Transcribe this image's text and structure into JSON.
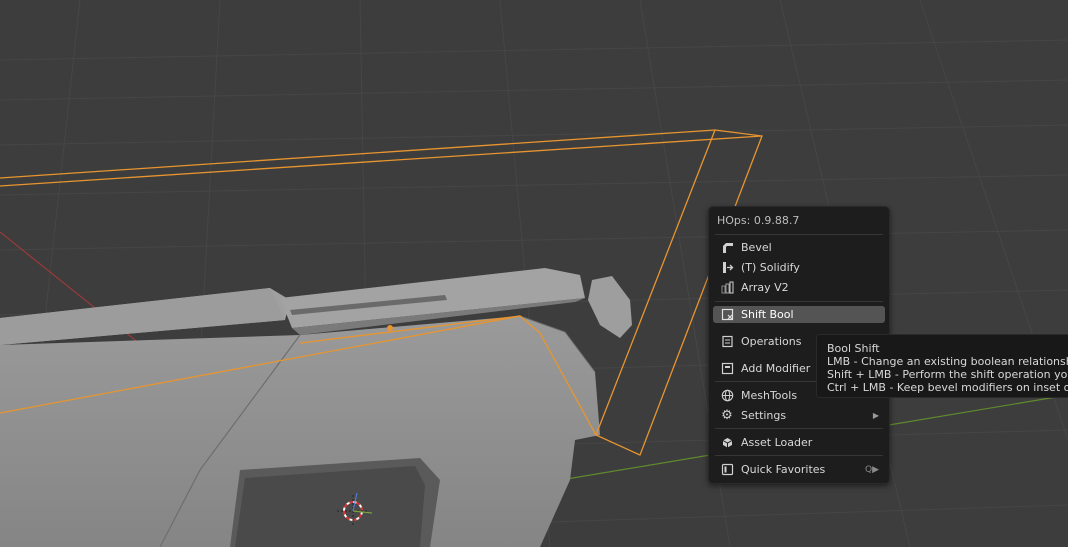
{
  "menu": {
    "title": "HOps: 0.9.88.7",
    "items": [
      {
        "label": "Bevel",
        "icon": "bevel-icon"
      },
      {
        "label": "(T) Solidify",
        "icon": "solidify-icon"
      },
      {
        "label": "Array V2",
        "icon": "array-icon"
      },
      {
        "label": "Shift Bool",
        "icon": "shift-bool-icon",
        "active": true
      },
      {
        "label": "Operations",
        "icon": "operations-icon"
      },
      {
        "label": "Add Modifier",
        "icon": "add-modifier-icon"
      },
      {
        "label": "MeshTools",
        "icon": "globe-icon"
      },
      {
        "label": "Settings",
        "icon": "gear-icon",
        "submenu": true
      },
      {
        "label": "Asset Loader",
        "icon": "asset-loader-icon"
      },
      {
        "label": "Quick Favorites",
        "icon": "quick-favorites-icon",
        "shortcut": "Q"
      }
    ]
  },
  "tooltip": {
    "title": "Bool Shift",
    "lines": [
      "LMB - Change an existing boolean relationship",
      "Shift + LMB - Perform the shift operation you",
      "Ctrl + LMB - Keep bevel modifiers on inset ob"
    ]
  },
  "colors": {
    "viewport_bg": "#3d3d3d",
    "grid_line": "#464646",
    "selection_outline": "#e8952f",
    "model_gray": "#8c8c8c",
    "x_axis": "#9a3a3a",
    "y_axis": "#5f8a2e",
    "menu_bg": "#1d1d1d",
    "menu_active": "#545454"
  }
}
